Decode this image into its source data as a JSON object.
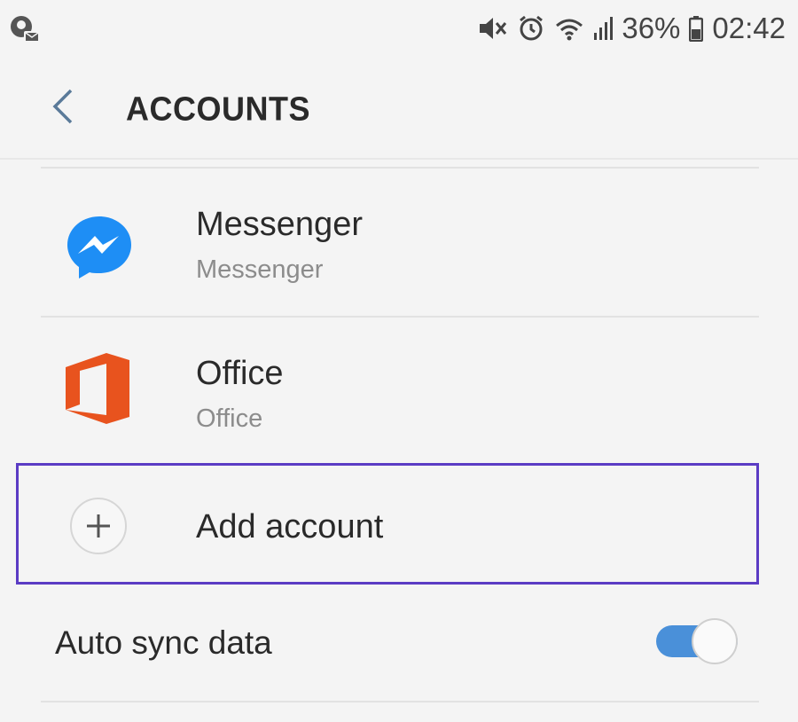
{
  "status_bar": {
    "battery_percent": "36%",
    "time": "02:42",
    "left_icon": "notification-icon",
    "icons": [
      "mute-icon",
      "alarm-icon",
      "wifi-icon",
      "signal-icon",
      "battery-icon"
    ]
  },
  "app_bar": {
    "title": "ACCOUNTS",
    "back_icon": "chevron-left-icon"
  },
  "accounts": [
    {
      "name": "Messenger",
      "subtitle": "Messenger",
      "icon": "messenger-icon"
    },
    {
      "name": "Office",
      "subtitle": "Office",
      "icon": "office-icon"
    }
  ],
  "add_account": {
    "label": "Add account",
    "icon": "plus-icon",
    "highlight_color": "#5b3cc4"
  },
  "auto_sync": {
    "label": "Auto sync data",
    "enabled": true,
    "accent_color": "#4a90d9"
  }
}
